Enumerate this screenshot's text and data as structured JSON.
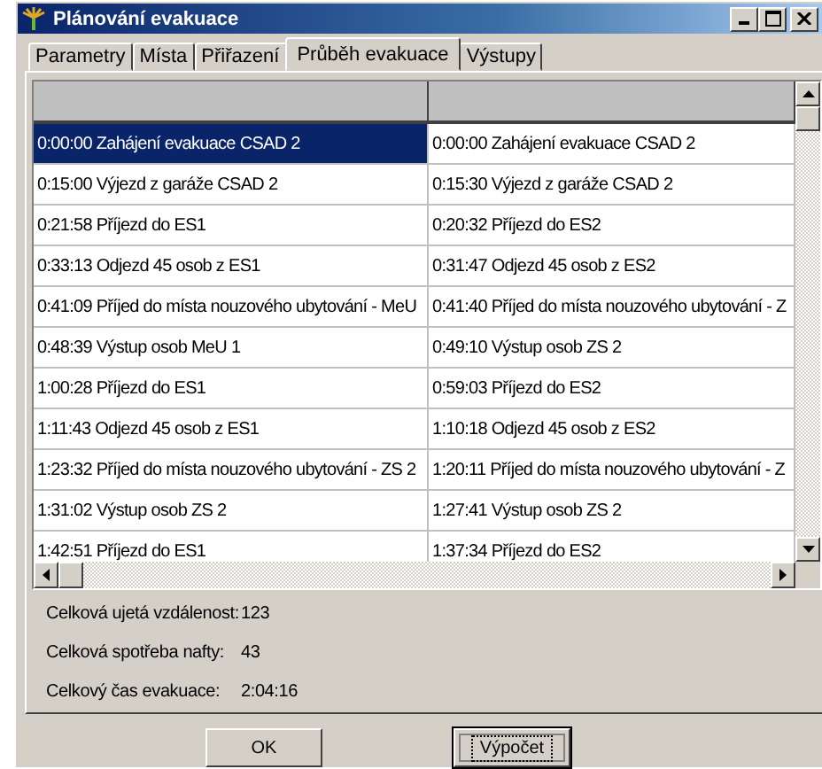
{
  "window": {
    "title": "Plánování evakuace"
  },
  "tabs": [
    {
      "label": "Parametry",
      "selected": false
    },
    {
      "label": "Místa",
      "selected": false
    },
    {
      "label": "Přiřazení",
      "selected": false
    },
    {
      "label": "Průběh evakuace",
      "selected": true
    },
    {
      "label": "Výstupy",
      "selected": false
    }
  ],
  "grid": {
    "rows": [
      {
        "cells": [
          {
            "text": "0:00:00 Zahájení evakuace  CSAD 2",
            "selected": true
          },
          {
            "text": "0:00:00 Zahájení evakuace  CSAD 2",
            "selected": false
          }
        ]
      },
      {
        "cells": [
          {
            "text": "0:15:00 Výjezd z garáže  CSAD 2",
            "selected": false
          },
          {
            "text": "0:15:30 Výjezd z garáže  CSAD 2",
            "selected": false
          }
        ]
      },
      {
        "cells": [
          {
            "text": "0:21:58 Příjezd do  ES1",
            "selected": false
          },
          {
            "text": "0:20:32 Příjezd do  ES2",
            "selected": false
          }
        ]
      },
      {
        "cells": [
          {
            "text": "0:33:13 Odjezd 45 osob z  ES1",
            "selected": false
          },
          {
            "text": "0:31:47 Odjezd 45 osob z  ES2",
            "selected": false
          }
        ]
      },
      {
        "cells": [
          {
            "text": "0:41:09 Příjed do místa nouzového ubytování -  MeU",
            "selected": false
          },
          {
            "text": "0:41:40 Příjed do místa nouzového ubytování -  Z",
            "selected": false
          }
        ]
      },
      {
        "cells": [
          {
            "text": "0:48:39 Výstup osob  MeU 1",
            "selected": false
          },
          {
            "text": "0:49:10 Výstup osob  ZS 2",
            "selected": false
          }
        ]
      },
      {
        "cells": [
          {
            "text": "1:00:28 Příjezd do  ES1",
            "selected": false
          },
          {
            "text": "0:59:03 Příjezd do  ES2",
            "selected": false
          }
        ]
      },
      {
        "cells": [
          {
            "text": "1:11:43 Odjezd 45 osob z  ES1",
            "selected": false
          },
          {
            "text": "1:10:18 Odjezd 45 osob z  ES2",
            "selected": false
          }
        ]
      },
      {
        "cells": [
          {
            "text": "1:23:32 Příjed do místa nouzového ubytování -  ZS 2",
            "selected": false
          },
          {
            "text": "1:20:11 Příjed do místa nouzového ubytování -  Z",
            "selected": false
          }
        ]
      },
      {
        "cells": [
          {
            "text": "1:31:02 Výstup osob  ZS 2",
            "selected": false
          },
          {
            "text": "1:27:41 Výstup osob  ZS 2",
            "selected": false
          }
        ]
      },
      {
        "cells": [
          {
            "text": "1:42:51 Příjezd do  ES1",
            "selected": false
          },
          {
            "text": "1:37:34 Příjezd do  ES2",
            "selected": false
          }
        ]
      }
    ]
  },
  "summary": [
    {
      "label": "Celková ujetá vzdálenost:",
      "value": "123"
    },
    {
      "label": "Celková spotřeba nafty:",
      "value": "43"
    },
    {
      "label": "Celkový čas evakuace:",
      "value": "2:04:16"
    }
  ],
  "buttons": [
    {
      "label": "OK",
      "focused": false
    },
    {
      "label": "Výpočet",
      "focused": true
    }
  ]
}
